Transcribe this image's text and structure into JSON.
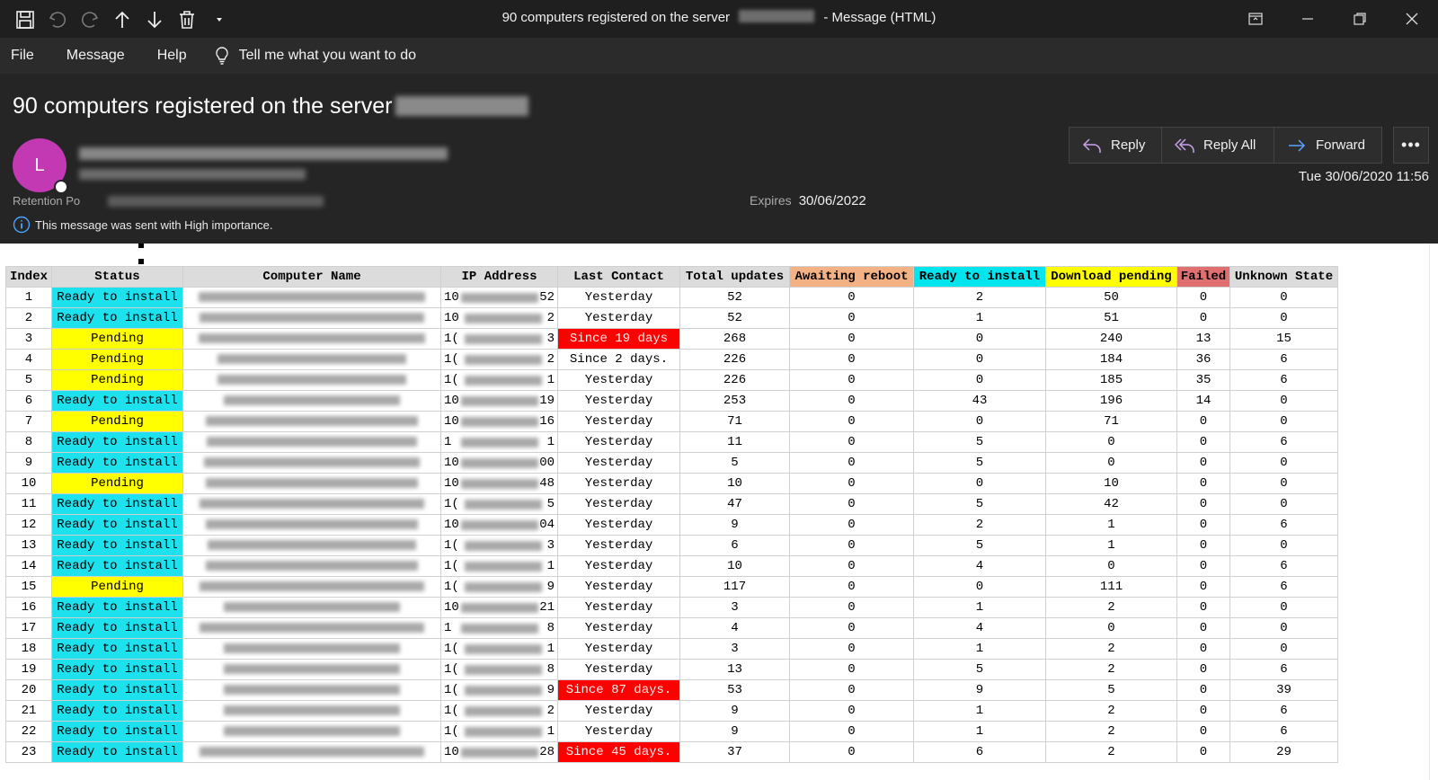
{
  "window": {
    "title_prefix": "90 computers registered on the server",
    "title_suffix": "- Message (HTML)"
  },
  "menu": {
    "file": "File",
    "message": "Message",
    "help": "Help",
    "tell_me": "Tell me what you want to do"
  },
  "header": {
    "subject": "90 computers registered on the server",
    "avatar_letter": "L",
    "retention_label": "Retention Po",
    "expires_label": "Expires",
    "expires_value": "30/06/2022",
    "importance_text": "This message was sent with High importance.",
    "date": "Tue 30/06/2020 11:56",
    "reply": "Reply",
    "reply_all": "Reply All",
    "forward": "Forward",
    "more": "•••"
  },
  "table": {
    "headers": [
      "Index",
      "Status",
      "Computer Name",
      "IP Address",
      "Last Contact",
      "Total updates",
      "Awaiting reboot",
      "Ready to install",
      "Download pending",
      "Failed",
      "Unknown State"
    ],
    "header_colors": {
      "awaiting": "#f4b183",
      "ready": "#00e5ee",
      "download": "#ffff00",
      "failed": "#e07070"
    },
    "rows": [
      {
        "index": "1",
        "status": "Ready to install",
        "ip_pre": "10",
        "ip_suf": "52",
        "last": "Yesterday",
        "total": "52",
        "await": "0",
        "ready": "2",
        "dl": "50",
        "failed": "0",
        "unknown": "0"
      },
      {
        "index": "2",
        "status": "Ready to install",
        "ip_pre": "10",
        "ip_suf": "2",
        "last": "Yesterday",
        "total": "52",
        "await": "0",
        "ready": "1",
        "dl": "51",
        "failed": "0",
        "unknown": "0"
      },
      {
        "index": "3",
        "status": "Pending",
        "ip_pre": "1(",
        "ip_suf": "3",
        "last": "Since 19 days",
        "total": "268",
        "await": "0",
        "ready": "0",
        "dl": "240",
        "failed": "13",
        "unknown": "15"
      },
      {
        "index": "4",
        "status": "Pending",
        "ip_pre": "1(",
        "ip_suf": "2",
        "last": "Since 2 days.",
        "total": "226",
        "await": "0",
        "ready": "0",
        "dl": "184",
        "failed": "36",
        "unknown": "6"
      },
      {
        "index": "5",
        "status": "Pending",
        "ip_pre": "1(",
        "ip_suf": "1",
        "last": "Yesterday",
        "total": "226",
        "await": "0",
        "ready": "0",
        "dl": "185",
        "failed": "35",
        "unknown": "6"
      },
      {
        "index": "6",
        "status": "Ready to install",
        "ip_pre": "10",
        "ip_suf": "19",
        "last": "Yesterday",
        "total": "253",
        "await": "0",
        "ready": "43",
        "dl": "196",
        "failed": "14",
        "unknown": "0"
      },
      {
        "index": "7",
        "status": "Pending",
        "ip_pre": "10",
        "ip_suf": "16",
        "last": "Yesterday",
        "total": "71",
        "await": "0",
        "ready": "0",
        "dl": "71",
        "failed": "0",
        "unknown": "0"
      },
      {
        "index": "8",
        "status": "Ready to install",
        "ip_pre": "1",
        "ip_suf": "1",
        "last": "Yesterday",
        "total": "11",
        "await": "0",
        "ready": "5",
        "dl": "0",
        "failed": "0",
        "unknown": "6"
      },
      {
        "index": "9",
        "status": "Ready to install",
        "ip_pre": "10",
        "ip_suf": "00",
        "last": "Yesterday",
        "total": "5",
        "await": "0",
        "ready": "5",
        "dl": "0",
        "failed": "0",
        "unknown": "0"
      },
      {
        "index": "10",
        "status": "Pending",
        "ip_pre": "10",
        "ip_suf": "48",
        "last": "Yesterday",
        "total": "10",
        "await": "0",
        "ready": "0",
        "dl": "10",
        "failed": "0",
        "unknown": "0"
      },
      {
        "index": "11",
        "status": "Ready to install",
        "ip_pre": "1(",
        "ip_suf": "5",
        "last": "Yesterday",
        "total": "47",
        "await": "0",
        "ready": "5",
        "dl": "42",
        "failed": "0",
        "unknown": "0"
      },
      {
        "index": "12",
        "status": "Ready to install",
        "ip_pre": "10",
        "ip_suf": "04",
        "last": "Yesterday",
        "total": "9",
        "await": "0",
        "ready": "2",
        "dl": "1",
        "failed": "0",
        "unknown": "6"
      },
      {
        "index": "13",
        "status": "Ready to install",
        "ip_pre": "1(",
        "ip_suf": "3",
        "last": "Yesterday",
        "total": "6",
        "await": "0",
        "ready": "5",
        "dl": "1",
        "failed": "0",
        "unknown": "0"
      },
      {
        "index": "14",
        "status": "Ready to install",
        "ip_pre": "1(",
        "ip_suf": "1",
        "last": "Yesterday",
        "total": "10",
        "await": "0",
        "ready": "4",
        "dl": "0",
        "failed": "0",
        "unknown": "6"
      },
      {
        "index": "15",
        "status": "Pending",
        "ip_pre": "1(",
        "ip_suf": "9",
        "last": "Yesterday",
        "total": "117",
        "await": "0",
        "ready": "0",
        "dl": "111",
        "failed": "0",
        "unknown": "6"
      },
      {
        "index": "16",
        "status": "Ready to install",
        "ip_pre": "10",
        "ip_suf": "21",
        "last": "Yesterday",
        "total": "3",
        "await": "0",
        "ready": "1",
        "dl": "2",
        "failed": "0",
        "unknown": "0"
      },
      {
        "index": "17",
        "status": "Ready to install",
        "ip_pre": "1",
        "ip_suf": "8",
        "last": "Yesterday",
        "total": "4",
        "await": "0",
        "ready": "4",
        "dl": "0",
        "failed": "0",
        "unknown": "0"
      },
      {
        "index": "18",
        "status": "Ready to install",
        "ip_pre": "1(",
        "ip_suf": "1",
        "last": "Yesterday",
        "total": "3",
        "await": "0",
        "ready": "1",
        "dl": "2",
        "failed": "0",
        "unknown": "0"
      },
      {
        "index": "19",
        "status": "Ready to install",
        "ip_pre": "1(",
        "ip_suf": "8",
        "last": "Yesterday",
        "total": "13",
        "await": "0",
        "ready": "5",
        "dl": "2",
        "failed": "0",
        "unknown": "6"
      },
      {
        "index": "20",
        "status": "Ready to install",
        "ip_pre": "1(",
        "ip_suf": "9",
        "last": "Since 87 days.",
        "total": "53",
        "await": "0",
        "ready": "9",
        "dl": "5",
        "failed": "0",
        "unknown": "39"
      },
      {
        "index": "21",
        "status": "Ready to install",
        "ip_pre": "1(",
        "ip_suf": "2",
        "last": "Yesterday",
        "total": "9",
        "await": "0",
        "ready": "1",
        "dl": "2",
        "failed": "0",
        "unknown": "6"
      },
      {
        "index": "22",
        "status": "Ready to install",
        "ip_pre": "1(",
        "ip_suf": "1",
        "last": "Yesterday",
        "total": "9",
        "await": "0",
        "ready": "1",
        "dl": "2",
        "failed": "0",
        "unknown": "6"
      },
      {
        "index": "23",
        "status": "Ready to install",
        "ip_pre": "10",
        "ip_suf": "28",
        "last": "Since 45 days.",
        "total": "37",
        "await": "0",
        "ready": "6",
        "dl": "2",
        "failed": "0",
        "unknown": "29"
      }
    ]
  }
}
